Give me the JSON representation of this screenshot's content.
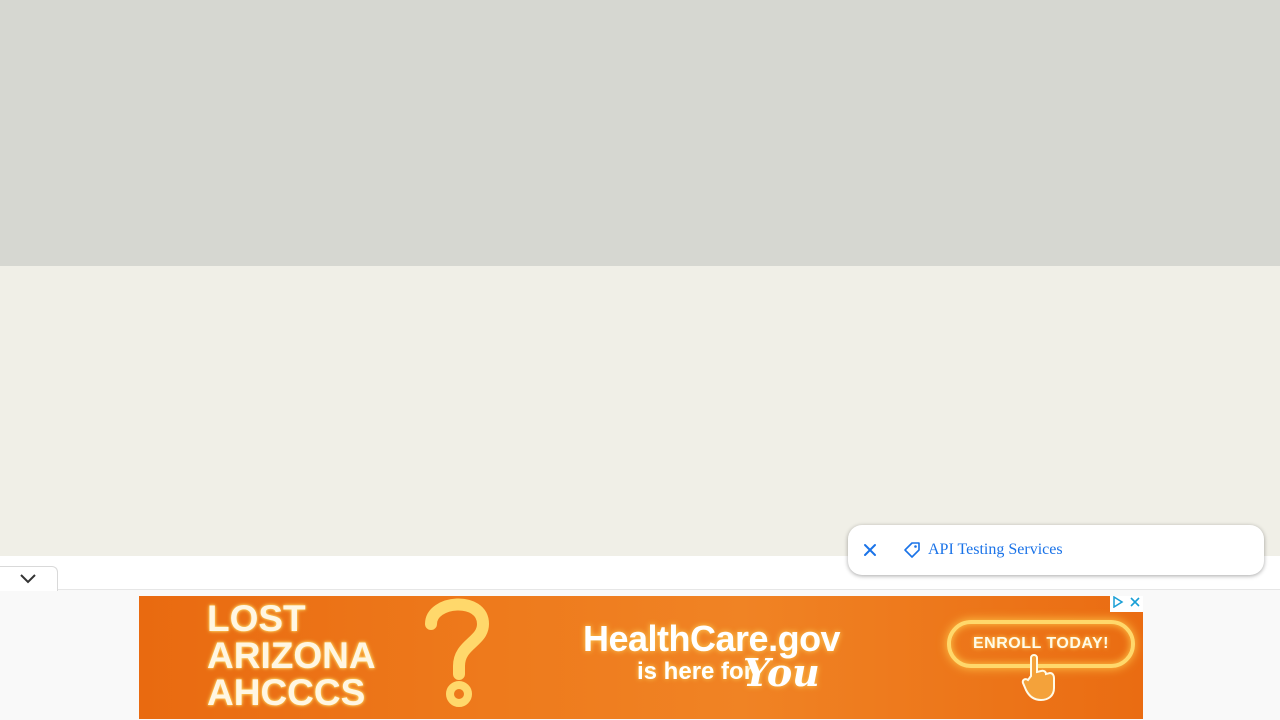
{
  "suggestion_chip": {
    "label": "API Testing Services",
    "accent_color": "#1a73e8"
  },
  "ad": {
    "headline_lines": [
      "LOST",
      "ARIZONA",
      "AHCCCS"
    ],
    "brand": "HealthCare.gov",
    "tagline": "is here for",
    "tagline_emphasis": "You",
    "cta_label": "ENROLL TODAY!",
    "colors": {
      "background": "#ee7a1c",
      "glow": "#ffd86b"
    }
  },
  "icons": {
    "close": "close-icon",
    "tag": "tag-icon",
    "collapse": "chevron-down-icon",
    "adchoices": "adchoices-icon",
    "ad_close": "ad-close-icon"
  }
}
